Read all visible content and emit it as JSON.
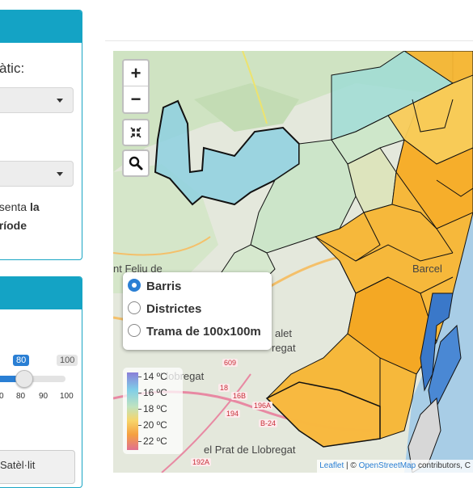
{
  "sidebar": {
    "panel1": {
      "label_partial": "àtic:",
      "desc_line1_prefix": "esenta ",
      "desc_line1_bold": "la",
      "desc_line2_bold": "eríode"
    },
    "panel2": {
      "slider_value": "80",
      "slider_max": "100",
      "slider_fraction": 0.8,
      "ticks": [
        "0",
        "80",
        "90",
        "100"
      ],
      "bottom_button_partial": "Satèl·lit"
    }
  },
  "map": {
    "zoom_in": "+",
    "zoom_out": "−",
    "fullscreen_icon": "collapse-icon",
    "search_icon": "search-icon",
    "layers": {
      "options": [
        "Barris",
        "Districtes",
        "Trama de 100x100m"
      ],
      "selected": "Barris"
    },
    "legend": {
      "labels": [
        "14 ºC",
        "16 ºC",
        "18 ºC",
        "20 ºC",
        "22 ºC"
      ],
      "colors": [
        "#8a7fd8",
        "#7fcde8",
        "#bfe3c0",
        "#f7d56a",
        "#f5a040",
        "#e07090"
      ]
    },
    "place_labels": {
      "feliu": "nt Feliu de",
      "llobregat": "Llobregat",
      "prat": "el Prat de Llobregat",
      "sant_joan": "alet",
      "sant_joan2": "regat",
      "barcelona": "Barcel"
    },
    "road_labels": [
      "609",
      "16B",
      "196A",
      "194",
      "18",
      "192A",
      "B-24"
    ],
    "attribution": {
      "leaflet": "Leaflet",
      "sep": " | © ",
      "osm": "OpenStreetMap",
      "rest": " contributors, C"
    }
  }
}
